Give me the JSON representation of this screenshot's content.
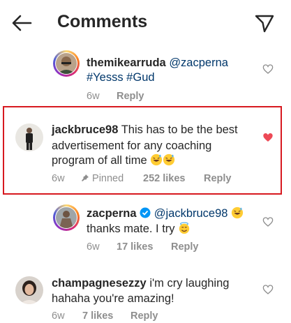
{
  "header": {
    "title": "Comments"
  },
  "comments": [
    {
      "username": "themikearruda",
      "mention": "@zacperna",
      "hashtags": "#Yesss #Gud",
      "time": "6w",
      "reply_label": "Reply"
    },
    {
      "username": "jackbruce98",
      "text_line1": "This has to be the best",
      "text_line2": "advertisement for any coaching",
      "text_line3": "program of all time",
      "time": "6w",
      "pinned_label": "Pinned",
      "likes": "252 likes",
      "reply_label": "Reply",
      "liked": true,
      "highlight_color": "#d7191f"
    },
    {
      "username": "zacperna",
      "mention": "@jackbruce98",
      "text_line2": "thanks mate. I try",
      "time": "6w",
      "likes": "17 likes",
      "reply_label": "Reply",
      "verified": true
    },
    {
      "username": "champagnesezzy",
      "text_line1": "i'm cry laughing",
      "text_line2": "hahaha you're amazing!",
      "time": "6w",
      "likes": "7 likes",
      "reply_label": "Reply"
    }
  ],
  "colors": {
    "like_red": "#ed4956",
    "mention_blue": "#00376b",
    "meta_gray": "#8e8e8e",
    "verified_blue": "#0095f6"
  }
}
